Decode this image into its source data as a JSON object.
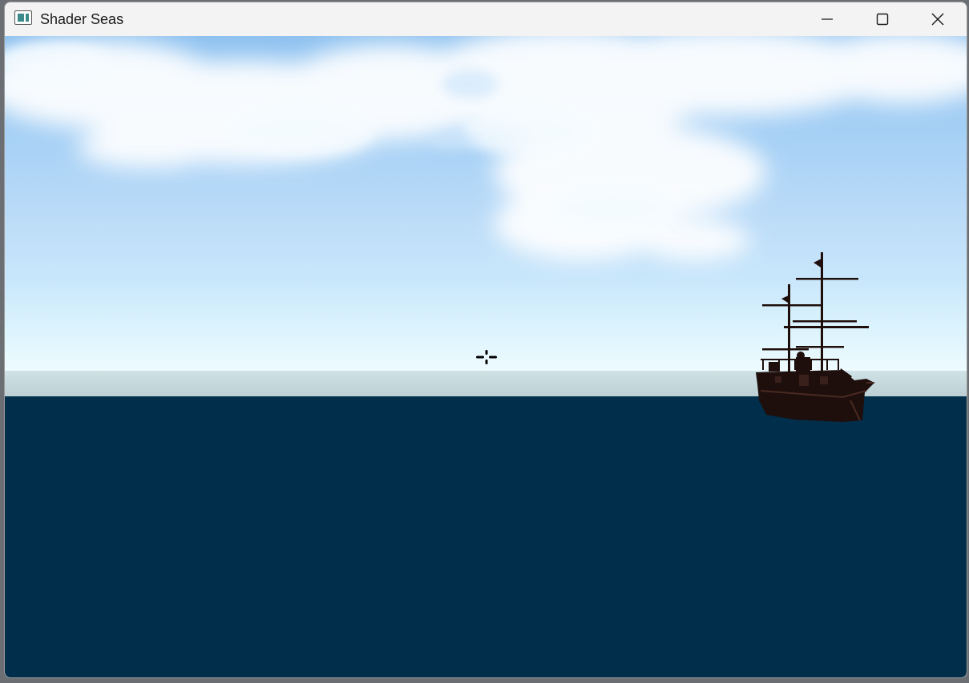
{
  "window": {
    "title": "Shader Seas",
    "icon": "app-window-icon",
    "controls": {
      "minimize_icon": "minimize-icon",
      "maximize_icon": "maximize-icon",
      "close_icon": "close-icon"
    }
  },
  "scene": {
    "sky_color": "#a6d0f5",
    "horizon_color": "#bccfd4",
    "sea_color": "#002e4b",
    "ship_color": "#1e0f0c",
    "crosshair_icon": "crosshair-icon"
  }
}
